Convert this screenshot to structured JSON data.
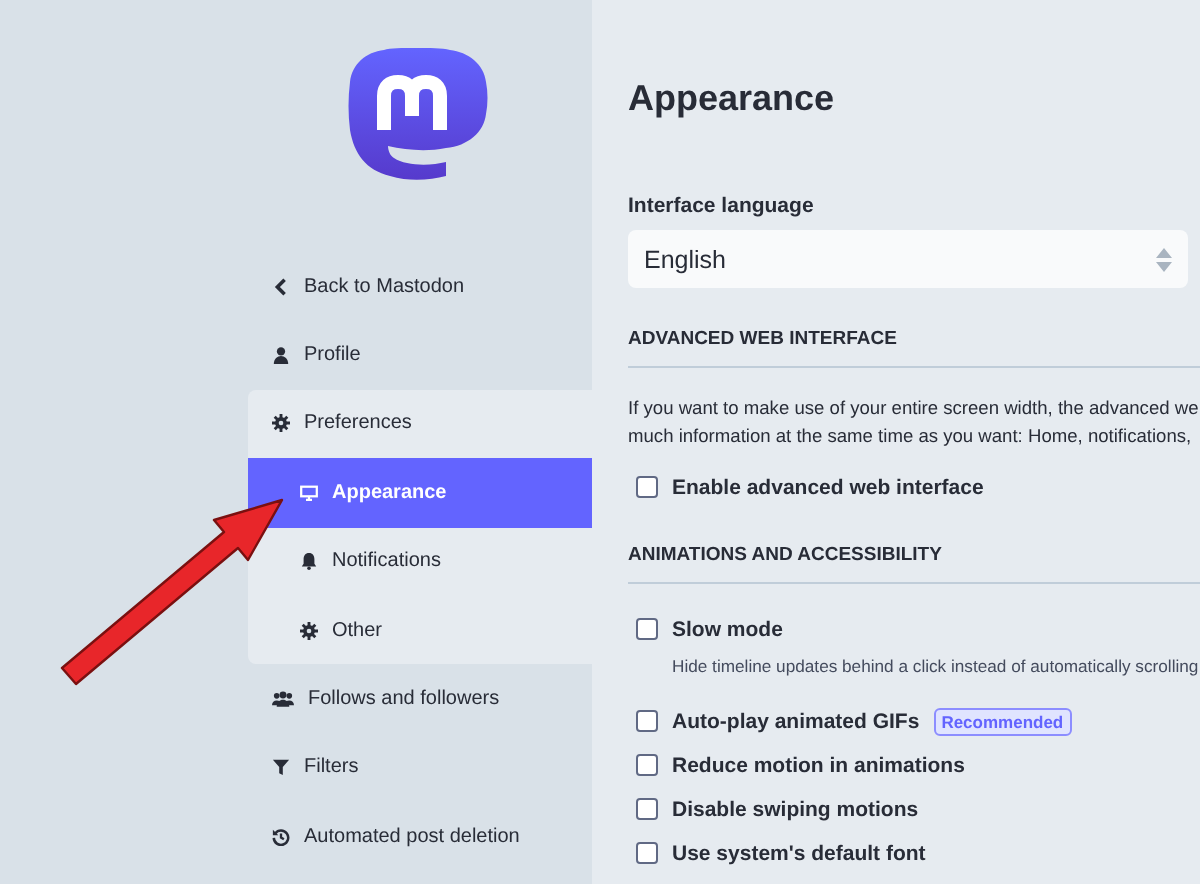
{
  "sidebar": {
    "items": [
      {
        "label": "Back to Mastodon",
        "selected": false
      },
      {
        "label": "Profile",
        "selected": false
      },
      {
        "label": "Preferences",
        "selected": false,
        "children": [
          {
            "label": "Appearance",
            "selected": true
          },
          {
            "label": "Notifications",
            "selected": false
          },
          {
            "label": "Other",
            "selected": false
          }
        ]
      },
      {
        "label": "Follows and followers",
        "selected": false
      },
      {
        "label": "Filters",
        "selected": false
      },
      {
        "label": "Automated post deletion",
        "selected": false
      }
    ]
  },
  "main": {
    "title": "Appearance",
    "language": {
      "label": "Interface language",
      "value": "English"
    },
    "sections": [
      {
        "heading": "ADVANCED WEB INTERFACE",
        "hint": "If you want to make use of your entire screen width, the advanced we",
        "hint2": "much information at the same time as you want: Home, notifications,",
        "options": [
          {
            "label": "Enable advanced web interface",
            "checked": false
          }
        ]
      },
      {
        "heading": "ANIMATIONS AND ACCESSIBILITY",
        "options": [
          {
            "label": "Slow mode",
            "checked": false,
            "hint": "Hide timeline updates behind a click instead of automatically scrolling"
          },
          {
            "label": "Auto-play animated GIFs",
            "checked": false,
            "badge": "Recommended"
          },
          {
            "label": "Reduce motion in animations",
            "checked": false
          },
          {
            "label": "Disable swiping motions",
            "checked": false
          },
          {
            "label": "Use system's default font",
            "checked": false
          }
        ]
      }
    ]
  }
}
